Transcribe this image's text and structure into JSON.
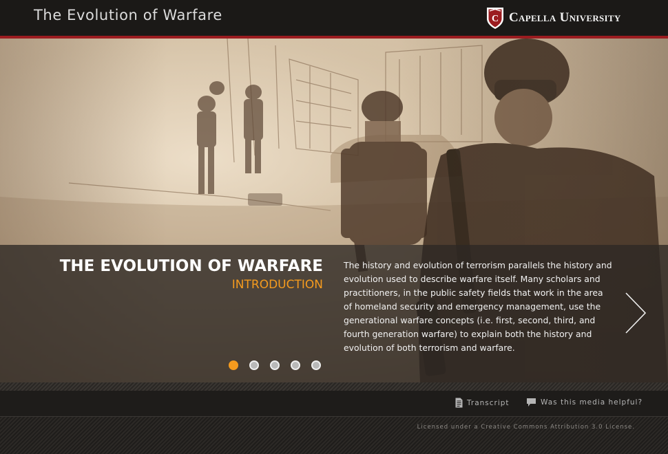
{
  "header": {
    "title": "The Evolution of Warfare",
    "logo_text": "Capella University"
  },
  "slide": {
    "title": "THE EVOLUTION OF WARFARE",
    "subtitle": "INTRODUCTION",
    "body": "The history and evolution of terrorism parallels the history and evolution used to describe warfare itself. Many scholars and practitioners, in the public safety fields that work in the area of homeland security and emergency management, use the generational warfare concepts (i.e. first, second, third, and fourth generation warfare) to explain both the history and evolution of both terrorism and warfare.",
    "image_description_icon": "sepia-soldiers-illustration",
    "next_icon": "chevron-right-icon",
    "pagination": {
      "total": 5,
      "current": 1
    }
  },
  "toolbar": {
    "transcript_label": "Transcript",
    "transcript_icon": "document-icon",
    "helpful_label": "Was this media helpful?",
    "helpful_icon": "speech-bubble-icon"
  },
  "footer": {
    "license": "Licensed under a Creative Commons Attribution 3.0 License."
  },
  "colors": {
    "header_bg": "#1b1917",
    "brand_red": "#9b1c20",
    "accent_orange": "#f59b1e",
    "overlay": "#2d2824"
  }
}
